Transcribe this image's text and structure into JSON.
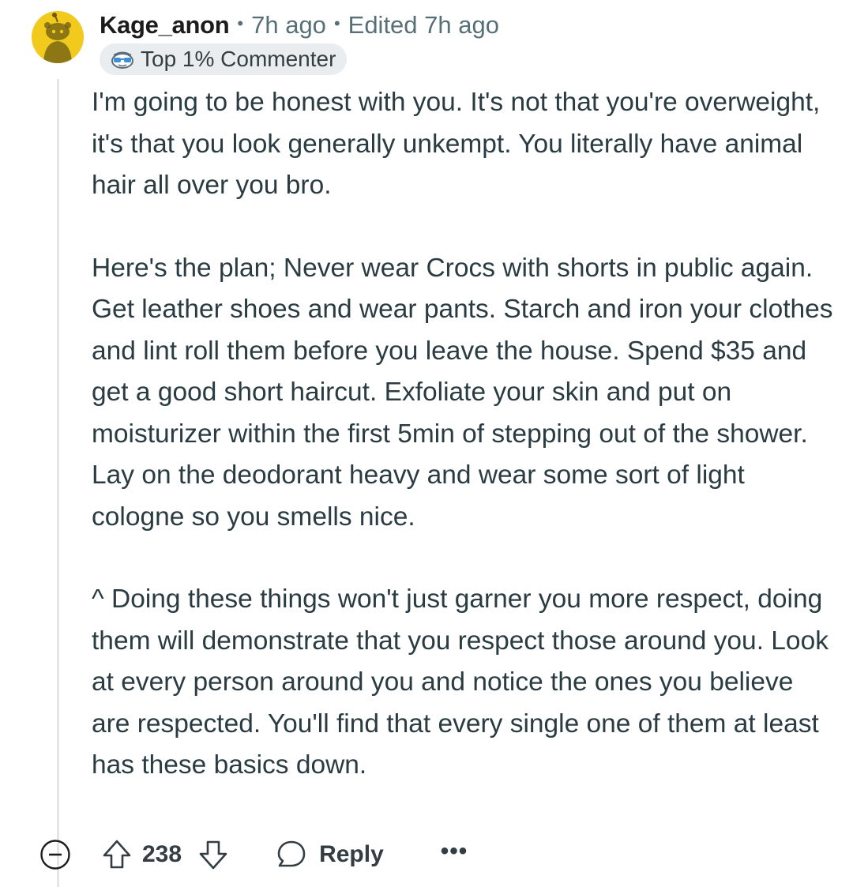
{
  "comment": {
    "author": "Kage_anon",
    "time": "7h ago",
    "edited": "Edited 7h ago",
    "separator": "•",
    "flair": {
      "label": "Top 1% Commenter",
      "icon": "sunglasses-icon"
    },
    "avatar": {
      "icon": "snoo-avatar-icon",
      "color": "#f2ca1d"
    },
    "paragraphs": [
      "I'm going to be honest with you. It's not that you're overweight, it's that you look generally unkempt. You literally have animal hair all over you bro.",
      "Here's the plan; Never wear Crocs with shorts in public again. Get leather shoes and wear pants. Starch and iron your clothes and lint roll them before you leave the house. Spend $35 and get a good short haircut. Exfoliate your skin and put on moisturizer within the first 5min of stepping out of the shower. Lay on the deodorant heavy and wear some sort of light cologne so you smells nice.",
      "^ Doing these things won't just garner you more respect, doing them will demonstrate that you respect those around you. Look at every person around you and notice the ones you believe are respected. You'll find that every single one of them at least has these basics down."
    ]
  },
  "actions": {
    "collapse_icon": "collapse-minus-icon",
    "upvote_icon": "upvote-arrow-icon",
    "score": "238",
    "downvote_icon": "downvote-arrow-icon",
    "reply_icon": "speech-bubble-icon",
    "reply_label": "Reply",
    "more_label": "•••"
  },
  "colors": {
    "text_primary": "#1c1c1c",
    "text_body": "#2a3c42",
    "text_meta": "#576f76",
    "flair_bg": "#eaedef",
    "thread_line": "#e4e6e8"
  }
}
